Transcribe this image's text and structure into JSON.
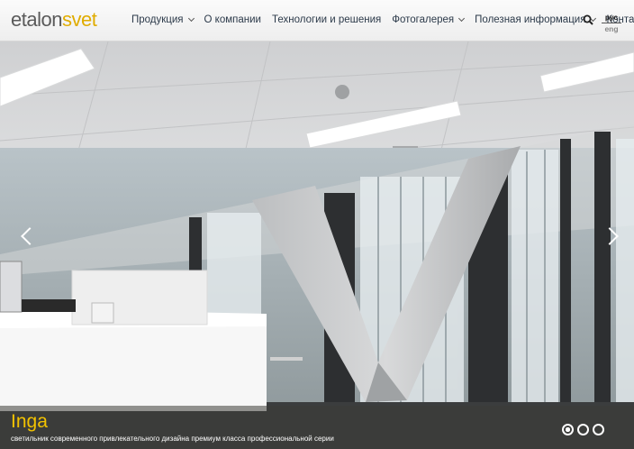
{
  "logo": {
    "part1": "etalon",
    "part2": "svet"
  },
  "nav": {
    "items": [
      {
        "label": "Продукция",
        "dropdown": true
      },
      {
        "label": "О компании",
        "dropdown": false
      },
      {
        "label": "Технологии и решения",
        "dropdown": false
      },
      {
        "label": "Фотогалерея",
        "dropdown": true
      },
      {
        "label": "Полезная информация",
        "dropdown": true
      },
      {
        "label": "Контакты",
        "dropdown": false
      }
    ]
  },
  "lang": {
    "current": "рус",
    "other": "eng"
  },
  "slider": {
    "title": "Inga",
    "subtitle": "светильник современного привлекательного дизайна премиум класса профессиональной серии",
    "slide_count": 3,
    "active_slide": 1
  },
  "colors": {
    "accent": "#f2c200",
    "logo_grey": "#5a5a5a"
  }
}
